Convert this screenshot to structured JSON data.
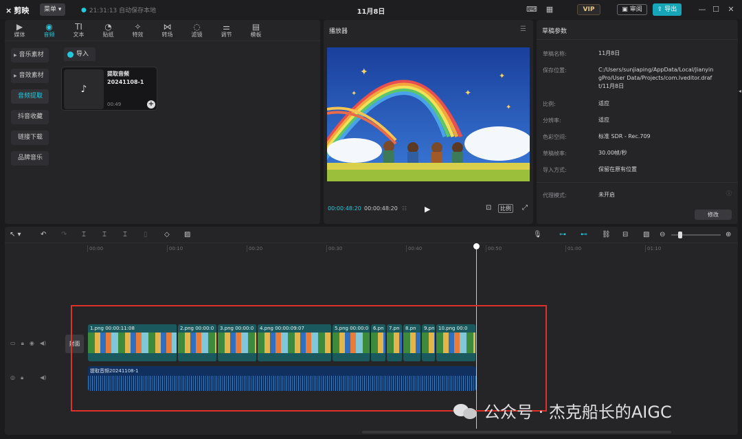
{
  "titlebar": {
    "logo": "剪映",
    "menu": "菜单",
    "autosave": "21:31:13 自动保存本地",
    "title": "11月8日",
    "vip": "VIP",
    "review": "审阅",
    "export": "导出"
  },
  "left_panel": {
    "tabs": [
      {
        "label": "媒体",
        "icon": "media-icon"
      },
      {
        "label": "音频",
        "icon": "audio-icon"
      },
      {
        "label": "文本",
        "icon": "text-icon"
      },
      {
        "label": "贴纸",
        "icon": "sticker-icon"
      },
      {
        "label": "特效",
        "icon": "effects-icon"
      },
      {
        "label": "转场",
        "icon": "transition-icon"
      },
      {
        "label": "滤镜",
        "icon": "filter-icon"
      },
      {
        "label": "调节",
        "icon": "adjust-icon"
      },
      {
        "label": "模板",
        "icon": "template-icon"
      }
    ],
    "sidebar": [
      "音乐素材",
      "音效素材",
      "音频提取",
      "抖音收藏",
      "链接下载",
      "品牌音乐"
    ],
    "import_label": "导入",
    "media_item": {
      "name": "提取音频20241108-1",
      "duration": "00:49"
    }
  },
  "player": {
    "title": "播放器",
    "current_time": "00:00:48:20",
    "total_time": "00:00:48:20",
    "ratio_label": "比例"
  },
  "props": {
    "title": "草稿参数",
    "rows": [
      {
        "label": "草稿名称:",
        "value": "11月8日"
      },
      {
        "label": "保存位置:",
        "value": "C:/Users/sunjiaping/AppData/Local/JianyingPro/User Data/Projects/com.lveditor.draft/11月8日"
      },
      {
        "label": "比例:",
        "value": "适应"
      },
      {
        "label": "分辨率:",
        "value": "适应"
      },
      {
        "label": "色彩空间:",
        "value": "标准 SDR - Rec.709"
      },
      {
        "label": "草稿帧率:",
        "value": "30.00帧/秒"
      },
      {
        "label": "导入方式:",
        "value": "保留在原有位置"
      },
      {
        "label": "代理模式:",
        "value": "未开启"
      }
    ],
    "modify": "修改"
  },
  "timeline": {
    "ticks": [
      "00:00",
      "00:10",
      "00:20",
      "00:30",
      "00:40",
      "00:50",
      "01:00",
      "01:10"
    ],
    "cover": "封面",
    "clips": [
      {
        "label": "1.png  00:00:11:08"
      },
      {
        "label": "2.png  00:00:0"
      },
      {
        "label": "3.png  00:00:0"
      },
      {
        "label": "4.png  00:00:09:07"
      },
      {
        "label": "5.png  00:00:0"
      },
      {
        "label": "6.pn"
      },
      {
        "label": "7.pn"
      },
      {
        "label": "8.pn"
      },
      {
        "label": "9.pn"
      },
      {
        "label": "10.png  00:0"
      }
    ],
    "audio_label": "提取音频20241108-1"
  },
  "watermark": "公众号 · 杰克船长的AIGC",
  "colors": {
    "accent": "#22c8de",
    "highlight": "#e0302a",
    "export": "#17a5b8"
  }
}
